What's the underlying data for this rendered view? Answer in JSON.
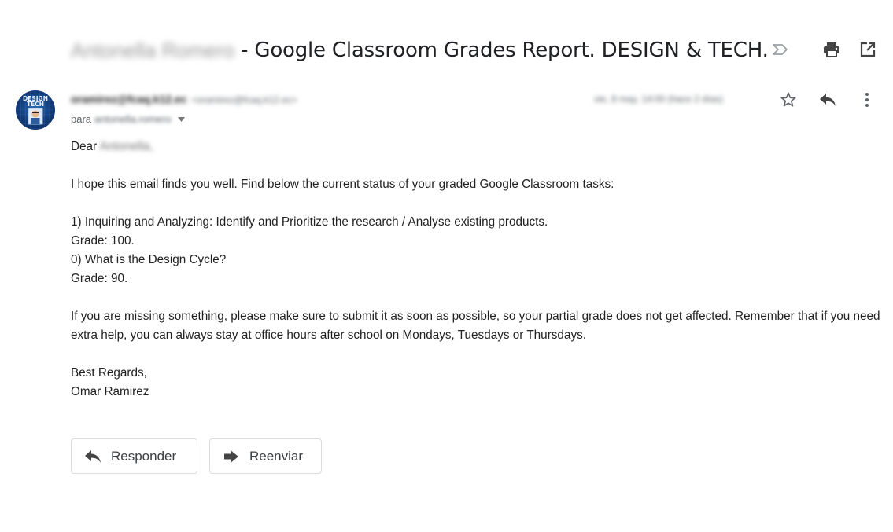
{
  "subject": {
    "recipient_name": "Antonella Romero",
    "title": "- Google Classroom Grades Report. DESIGN & TECH."
  },
  "icons": {
    "label": "label-importance-icon",
    "print": "print-icon",
    "open_new": "open-in-new-icon",
    "star": "star-icon",
    "reply": "reply-icon",
    "more": "more-vert-icon",
    "dropdown": "caret-down-icon",
    "forward": "forward-icon"
  },
  "avatar": {
    "line1": "DESIGN",
    "line2": "TECH"
  },
  "sender": {
    "name": "oramirez@fcaq.k12.ec",
    "email": "<oramirez@fcaq.k12.ec>",
    "to_prefix": "para",
    "to_name": "antonella.romero",
    "date": "vie, 8 may. 14:00 (hace 2 días)"
  },
  "message": {
    "greeting": "Dear",
    "greeting_name": "Antonella",
    "greeting_suffix": ",",
    "intro": "I hope this email finds you well. Find below the current status of your graded Google Classroom tasks:",
    "task1": "1) Inquiring and Analyzing: Identify and Prioritize the research / Analyse existing products.",
    "grade1": "Grade: 100.",
    "task2": "0) What is the Design Cycle?",
    "grade2": "Grade: 90.",
    "note": "If you are missing something, please make sure to submit it as soon as possible, so your partial grade does not get affected. Remember that if you need extra help, you can always stay at office hours after school on Mondays, Tuesdays or Thursdays.",
    "closing": "Best Regards,",
    "signature": "Omar Ramirez"
  },
  "actions": {
    "reply_label": "Responder",
    "forward_label": "Reenviar"
  }
}
